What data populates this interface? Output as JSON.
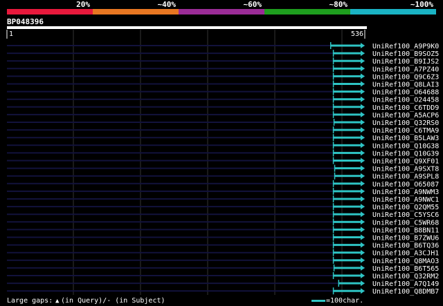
{
  "query_id": "BP048396",
  "scale": {
    "labels": [
      "20%",
      "~40%",
      "~60%",
      "~80%",
      "~100%"
    ],
    "colors": [
      "#e8193c",
      "#e87722",
      "#9b2c97",
      "#1e9e1e",
      "#1ab3c4"
    ]
  },
  "ruler": {
    "start_label": "1",
    "end_label": "536"
  },
  "footer": {
    "gaps_prefix": "Large gaps:",
    "gaps_text": "(in Query)/- (in Subject)",
    "legend_text": "=100char."
  },
  "colors": {
    "background": "#000000",
    "guide": "#12123c",
    "hit": "#2ec4c4",
    "grid": "#333333"
  },
  "chart_data": {
    "type": "alignment",
    "query_length": 536,
    "xlim": [
      1,
      536
    ],
    "series": [
      {
        "name": "UniRef100_A9P9K0",
        "start": 485,
        "end": 536
      },
      {
        "name": "UniRef100_B9SOZ5",
        "start": 489,
        "end": 536
      },
      {
        "name": "UniRef100_B9IJS2",
        "start": 489,
        "end": 536
      },
      {
        "name": "UniRef100_A7PZ40",
        "start": 489,
        "end": 536
      },
      {
        "name": "UniRef100_Q9C6Z3",
        "start": 489,
        "end": 536
      },
      {
        "name": "UniRef100_Q8LAI3",
        "start": 489,
        "end": 536
      },
      {
        "name": "UniRef100_O64688",
        "start": 489,
        "end": 536
      },
      {
        "name": "UniRef100_O24458",
        "start": 489,
        "end": 536
      },
      {
        "name": "UniRef100_C6TDD9",
        "start": 489,
        "end": 536
      },
      {
        "name": "UniRef100_A5ACP6",
        "start": 489,
        "end": 536
      },
      {
        "name": "UniRef100_Q32RS0",
        "start": 490,
        "end": 536
      },
      {
        "name": "UniRef100_C6TMA9",
        "start": 489,
        "end": 536
      },
      {
        "name": "UniRef100_B5LAW3",
        "start": 489,
        "end": 536
      },
      {
        "name": "UniRef100_Q10G38",
        "start": 489,
        "end": 536
      },
      {
        "name": "UniRef100_Q10G39",
        "start": 489,
        "end": 536
      },
      {
        "name": "UniRef100_Q9XF01",
        "start": 489,
        "end": 536
      },
      {
        "name": "UniRef100_A9SXT8",
        "start": 491,
        "end": 536
      },
      {
        "name": "UniRef100_A9SPL8",
        "start": 491,
        "end": 536
      },
      {
        "name": "UniRef100_O65087",
        "start": 489,
        "end": 536
      },
      {
        "name": "UniRef100_A9NWM3",
        "start": 489,
        "end": 536
      },
      {
        "name": "UniRef100_A9NWC1",
        "start": 489,
        "end": 536
      },
      {
        "name": "UniRef100_Q2QM55",
        "start": 489,
        "end": 536
      },
      {
        "name": "UniRef100_C5YSC6",
        "start": 489,
        "end": 536
      },
      {
        "name": "UniRef100_C5WR68",
        "start": 489,
        "end": 536
      },
      {
        "name": "UniRef100_B8BN11",
        "start": 489,
        "end": 536
      },
      {
        "name": "UniRef100_B7ZWU6",
        "start": 489,
        "end": 536
      },
      {
        "name": "UniRef100_B6TQ36",
        "start": 489,
        "end": 536
      },
      {
        "name": "UniRef100_A3CJH1",
        "start": 489,
        "end": 536
      },
      {
        "name": "UniRef100_Q8MAO3",
        "start": 489,
        "end": 536
      },
      {
        "name": "UniRef100_B6T565",
        "start": 490,
        "end": 536
      },
      {
        "name": "UniRef100_Q32RM2",
        "start": 489,
        "end": 536
      },
      {
        "name": "UniRef100_A7Q149",
        "start": 497,
        "end": 536
      },
      {
        "name": "UniRef100_Q8DMB7",
        "start": 489,
        "end": 536
      }
    ]
  }
}
